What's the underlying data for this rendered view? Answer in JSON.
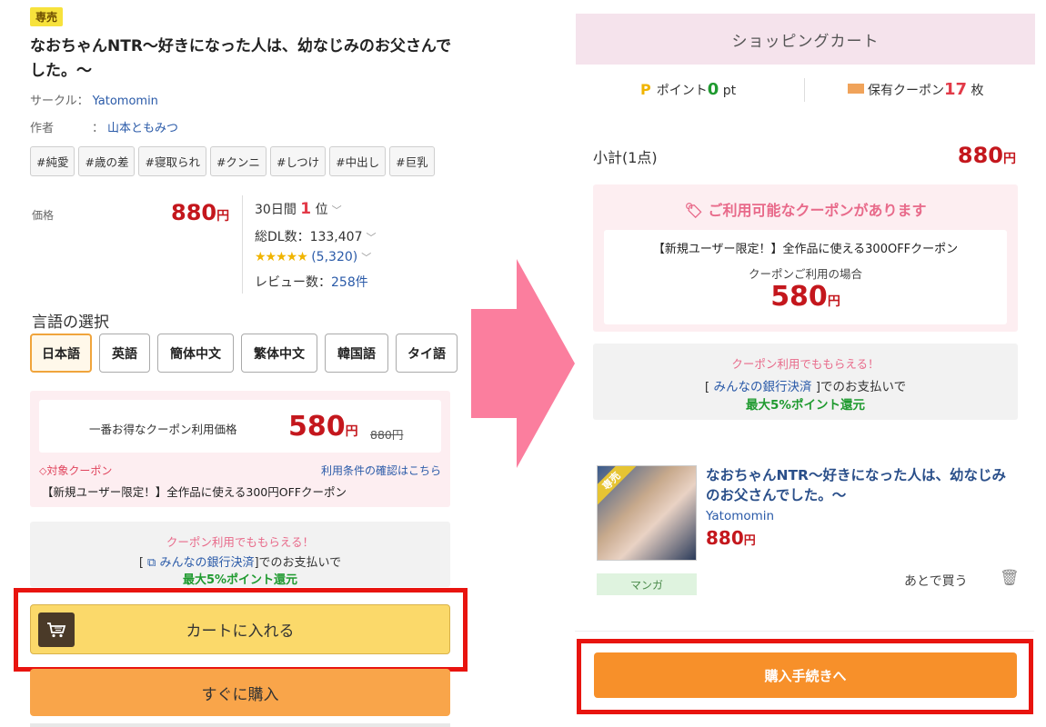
{
  "left": {
    "badge": "専売",
    "title": "なおちゃんNTR〜好きになった人は、幼なじみのお父さんでした。〜",
    "circle_label": "サークル：",
    "circle_value": "Yatomomin",
    "author_label": "作者",
    "author_sep": "：",
    "author_value": "山本ともみつ",
    "tags": [
      "#純愛",
      "#歳の差",
      "#寝取られ",
      "#クンニ",
      "#しつけ",
      "#中出し",
      "#巨乳"
    ],
    "price_label": "価格",
    "price_value": "880",
    "yen": "円",
    "rank_prefix": "30日間",
    "rank_num": "1",
    "rank_suffix": "位",
    "dl_text": "総DL数：133,407",
    "stars": "★★★★★",
    "rating_count": "(5,320)",
    "review_label": "レビュー数：",
    "review_value": "258件",
    "lang_title": "言語の選択",
    "languages": [
      "日本語",
      "英語",
      "簡体中文",
      "繁体中文",
      "韓国語",
      "タイ語"
    ],
    "coupon_best_label": "一番お得なクーポン利用価格",
    "coupon_price": "580",
    "coupon_original": "880円",
    "coupon_tag": "対象クーポン",
    "coupon_link": "利用条件の確認はこちら",
    "coupon_desc": "【新規ユーザー限定！】全作品に使える300円OFFクーポン",
    "pay_l1": "クーポン利用でももらえる！",
    "pay_l2_pre": "[",
    "pay_l2_link": "みんなの銀行決済",
    "pay_l2_post": "]でのお支払いで",
    "pay_l3": "最大5%ポイント還元",
    "cart_button": "カートに入れる",
    "buy_now": "すぐに購入"
  },
  "right": {
    "header": "ショッピングカート",
    "points_label": "ポイント",
    "points_value": "0",
    "points_unit": "pt",
    "coupon_label": "保有クーポン",
    "coupon_count": "17",
    "coupon_unit": "枚",
    "subtotal_label": "小計(1点)",
    "subtotal_value": "880",
    "yen": "円",
    "avail_title": "ご利用可能なクーポンがあります",
    "avail_desc": "【新規ユーザー限定！】全作品に使える300OFFクーポン",
    "avail_when": "クーポンご利用の場合",
    "avail_price": "580",
    "pay_l1": "クーポン利用でももらえる！",
    "pay_l2_pre": "[",
    "pay_l2_link": "みんなの銀行決済",
    "pay_l2_post": "]でのお支払いで",
    "pay_l3": "最大5%ポイント還元",
    "product": {
      "ribbon": "専売",
      "title": "なおちゃんNTR〜好きになった人は、幼なじみのお父さんでした。〜",
      "circle": "Yatomomin",
      "price": "880",
      "genre": "マンガ",
      "later": "あとで買う"
    },
    "checkout": "購入手続きへ"
  },
  "colors": {
    "price_red": "#c4171d",
    "accent_pink": "#e86a8a",
    "link_blue": "#2a5aa8",
    "green": "#1f9a2f",
    "highlight_red": "#e8140f",
    "cart_yellow": "#fbd96a",
    "orange": "#f7902a",
    "arrow_pink": "#fb7e9e"
  },
  "icons": [
    "cart-icon",
    "coupon-tag-icon",
    "bank-icon",
    "arrow-right-icon",
    "trash-icon",
    "points-icon",
    "coupon-ticket-icon"
  ]
}
